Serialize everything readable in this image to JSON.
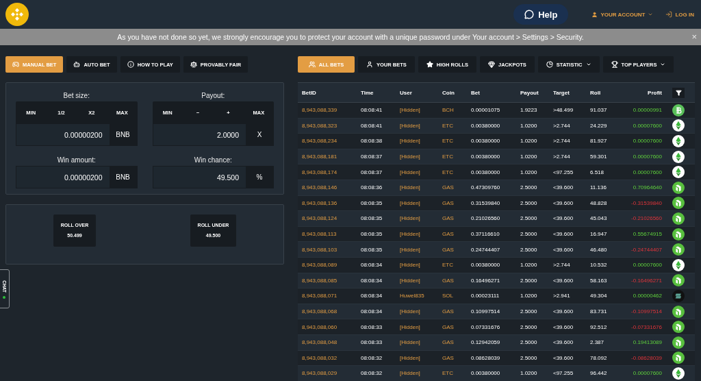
{
  "header": {
    "help_label": "Help",
    "account_label": "YOUR ACCOUNT",
    "login_label": "LOG IN"
  },
  "banner": {
    "text": "As you have not done so yet, we strongly encourage you to protect your account with a unique password under Your account > Settings > Security.",
    "close": "×"
  },
  "game_tabs": [
    {
      "label": "MANUAL BET",
      "selected": true
    },
    {
      "label": "AUTO BET",
      "selected": false
    },
    {
      "label": "HOW TO PLAY",
      "selected": false
    },
    {
      "label": "PROVABLY FAIR",
      "selected": false
    }
  ],
  "bet_form": {
    "bet_size": {
      "label": "Bet size:",
      "buttons": [
        "MIN",
        "1/2",
        "X2",
        "MAX"
      ],
      "value": "0.00000200",
      "unit": "BNB"
    },
    "payout": {
      "label": "Payout:",
      "buttons": [
        "MIN",
        "−",
        "+",
        "MAX"
      ],
      "value": "2.0000",
      "unit": "X"
    },
    "win_amount": {
      "label": "Win amount:",
      "value": "0.00000200",
      "unit": "BNB"
    },
    "win_chance": {
      "label": "Win chance:",
      "value": "49.500",
      "unit": "%"
    }
  },
  "roll_buttons": [
    {
      "label": "ROLL OVER",
      "value": "50.499"
    },
    {
      "label": "ROLL UNDER",
      "value": "49.500"
    }
  ],
  "chat_tab": {
    "label": "CHAT",
    "online": true
  },
  "bet_tabs": [
    {
      "label": "ALL BETS",
      "dropdown": false,
      "selected": true
    },
    {
      "label": "YOUR BETS",
      "dropdown": false,
      "selected": false
    },
    {
      "label": "HIGH ROLLS",
      "dropdown": false,
      "selected": false
    },
    {
      "label": "JACKPOTS",
      "dropdown": false,
      "selected": false
    },
    {
      "label": "STATISTIC",
      "dropdown": true,
      "selected": false
    },
    {
      "label": "TOP PLAYERS",
      "dropdown": true,
      "selected": false
    }
  ],
  "table": {
    "columns": [
      "BetID",
      "Time",
      "User",
      "Coin",
      "Bet",
      "Payout",
      "Target",
      "Roll",
      "Profit"
    ],
    "rows": [
      {
        "kind": "bch",
        "bet_id": "8,943,088,339",
        "time": "08:08:41",
        "user": "[Hidden]",
        "coin": "BCH",
        "bet": "0.00001075",
        "payout": "1.9223",
        "target": ">48.499",
        "roll": "91.037",
        "profit": "0.00000991",
        "win": true
      },
      {
        "kind": "etc",
        "bet_id": "8,943,088,323",
        "time": "08:08:41",
        "user": "[Hidden]",
        "coin": "ETC",
        "bet": "0.00380000",
        "payout": "1.0200",
        "target": ">2.744",
        "roll": "24.229",
        "profit": "0.00007600",
        "win": true
      },
      {
        "kind": "etc",
        "bet_id": "8,943,088,234",
        "time": "08:08:38",
        "user": "[Hidden]",
        "coin": "ETC",
        "bet": "0.00380000",
        "payout": "1.0200",
        "target": ">2.744",
        "roll": "81.927",
        "profit": "0.00007600",
        "win": true
      },
      {
        "kind": "etc",
        "bet_id": "8,943,088,181",
        "time": "08:08:37",
        "user": "[Hidden]",
        "coin": "ETC",
        "bet": "0.00380000",
        "payout": "1.0200",
        "target": ">2.744",
        "roll": "59.301",
        "profit": "0.00007600",
        "win": true
      },
      {
        "kind": "etc",
        "bet_id": "8,943,088,174",
        "time": "08:08:37",
        "user": "[Hidden]",
        "coin": "ETC",
        "bet": "0.00380000",
        "payout": "1.0200",
        "target": "<97.255",
        "roll": "6.518",
        "profit": "0.00007600",
        "win": true
      },
      {
        "kind": "gas",
        "bet_id": "8,943,088,146",
        "time": "08:08:36",
        "user": "[Hidden]",
        "coin": "GAS",
        "bet": "0.47309760",
        "payout": "2.5000",
        "target": "<39.600",
        "roll": "11.136",
        "profit": "0.70964640",
        "win": true
      },
      {
        "kind": "gas",
        "bet_id": "8,943,088,136",
        "time": "08:08:35",
        "user": "[Hidden]",
        "coin": "GAS",
        "bet": "0.31539840",
        "payout": "2.5000",
        "target": "<39.600",
        "roll": "48.828",
        "profit": "-0.31539840",
        "win": false
      },
      {
        "kind": "gas",
        "bet_id": "8,943,088,124",
        "time": "08:08:35",
        "user": "[Hidden]",
        "coin": "GAS",
        "bet": "0.21026560",
        "payout": "2.5000",
        "target": "<39.600",
        "roll": "45.043",
        "profit": "-0.21026560",
        "win": false
      },
      {
        "kind": "gas",
        "bet_id": "8,943,088,113",
        "time": "08:08:35",
        "user": "[Hidden]",
        "coin": "GAS",
        "bet": "0.37116610",
        "payout": "2.5000",
        "target": "<39.600",
        "roll": "16.947",
        "profit": "0.55674915",
        "win": true
      },
      {
        "kind": "gas",
        "bet_id": "8,943,088,103",
        "time": "08:08:35",
        "user": "[Hidden]",
        "coin": "GAS",
        "bet": "0.24744407",
        "payout": "2.5000",
        "target": "<39.600",
        "roll": "46.480",
        "profit": "-0.24744407",
        "win": false
      },
      {
        "kind": "etc",
        "bet_id": "8,943,088,089",
        "time": "08:08:34",
        "user": "[Hidden]",
        "coin": "ETC",
        "bet": "0.00380000",
        "payout": "1.0200",
        "target": ">2.744",
        "roll": "10.532",
        "profit": "0.00007600",
        "win": true
      },
      {
        "kind": "gas",
        "bet_id": "8,943,088,085",
        "time": "08:08:34",
        "user": "[Hidden]",
        "coin": "GAS",
        "bet": "0.16496271",
        "payout": "2.5000",
        "target": "<39.600",
        "roll": "58.163",
        "profit": "-0.16496271",
        "win": false
      },
      {
        "kind": "sol",
        "bet_id": "8,943,088,071",
        "time": "08:08:34",
        "user": "Huwel835",
        "coin": "SOL",
        "bet": "0.00023111",
        "payout": "1.0200",
        "target": ">2.941",
        "roll": "49.304",
        "profit": "0.00000462",
        "win": true
      },
      {
        "kind": "gas",
        "bet_id": "8,943,088,068",
        "time": "08:08:34",
        "user": "[Hidden]",
        "coin": "GAS",
        "bet": "0.10997514",
        "payout": "2.5000",
        "target": "<39.600",
        "roll": "83.731",
        "profit": "-0.10997514",
        "win": false
      },
      {
        "kind": "gas",
        "bet_id": "8,943,088,060",
        "time": "08:08:33",
        "user": "[Hidden]",
        "coin": "GAS",
        "bet": "0.07331676",
        "payout": "2.5000",
        "target": "<39.600",
        "roll": "92.512",
        "profit": "-0.07331676",
        "win": false
      },
      {
        "kind": "gas",
        "bet_id": "8,943,088,048",
        "time": "08:08:33",
        "user": "[Hidden]",
        "coin": "GAS",
        "bet": "0.12942059",
        "payout": "2.5000",
        "target": "<39.600",
        "roll": "2.387",
        "profit": "0.19413089",
        "win": true
      },
      {
        "kind": "gas",
        "bet_id": "8,943,088,032",
        "time": "08:08:32",
        "user": "[Hidden]",
        "coin": "GAS",
        "bet": "0.08628039",
        "payout": "2.5000",
        "target": "<39.600",
        "roll": "78.092",
        "profit": "-0.08628039",
        "win": false
      },
      {
        "kind": "etc",
        "bet_id": "8,943,088,029",
        "time": "08:08:32",
        "user": "[Hidden]",
        "coin": "ETC",
        "bet": "0.00380000",
        "payout": "1.0200",
        "target": "<97.255",
        "roll": "96.442",
        "profit": "0.00007600",
        "win": true
      }
    ]
  }
}
